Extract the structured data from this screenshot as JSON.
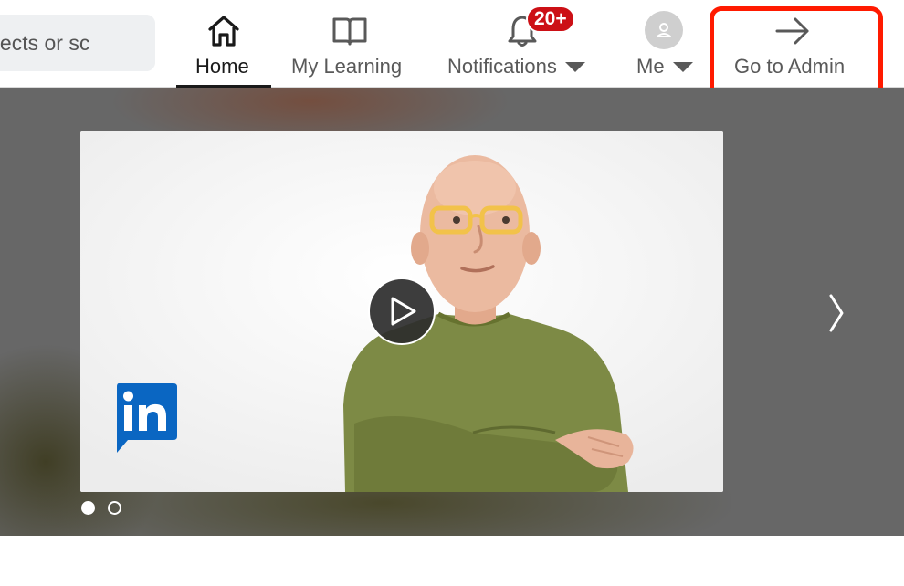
{
  "search": {
    "placeholder": "ojects or sc"
  },
  "nav": {
    "home": {
      "label": "Home",
      "icon": "home-icon",
      "active": true
    },
    "learning": {
      "label": "My Learning",
      "icon": "book-icon"
    },
    "notifications": {
      "label": "Notifications",
      "icon": "bell-icon",
      "badge": "20+"
    },
    "me": {
      "label": "Me",
      "icon": "avatar-icon"
    },
    "admin": {
      "label": "Go to Admin",
      "icon": "arrow-right-icon"
    }
  },
  "carousel": {
    "slide_count": 2,
    "active_slide": 1,
    "next_icon": "chevron-right-icon",
    "play_icon": "play-icon",
    "logo_icon": "linkedin-logo-icon"
  },
  "colors": {
    "badge": "#cc1016",
    "highlight": "#ff1a00",
    "hero_bg": "#676767",
    "linkedin_blue": "#0a66c2"
  }
}
